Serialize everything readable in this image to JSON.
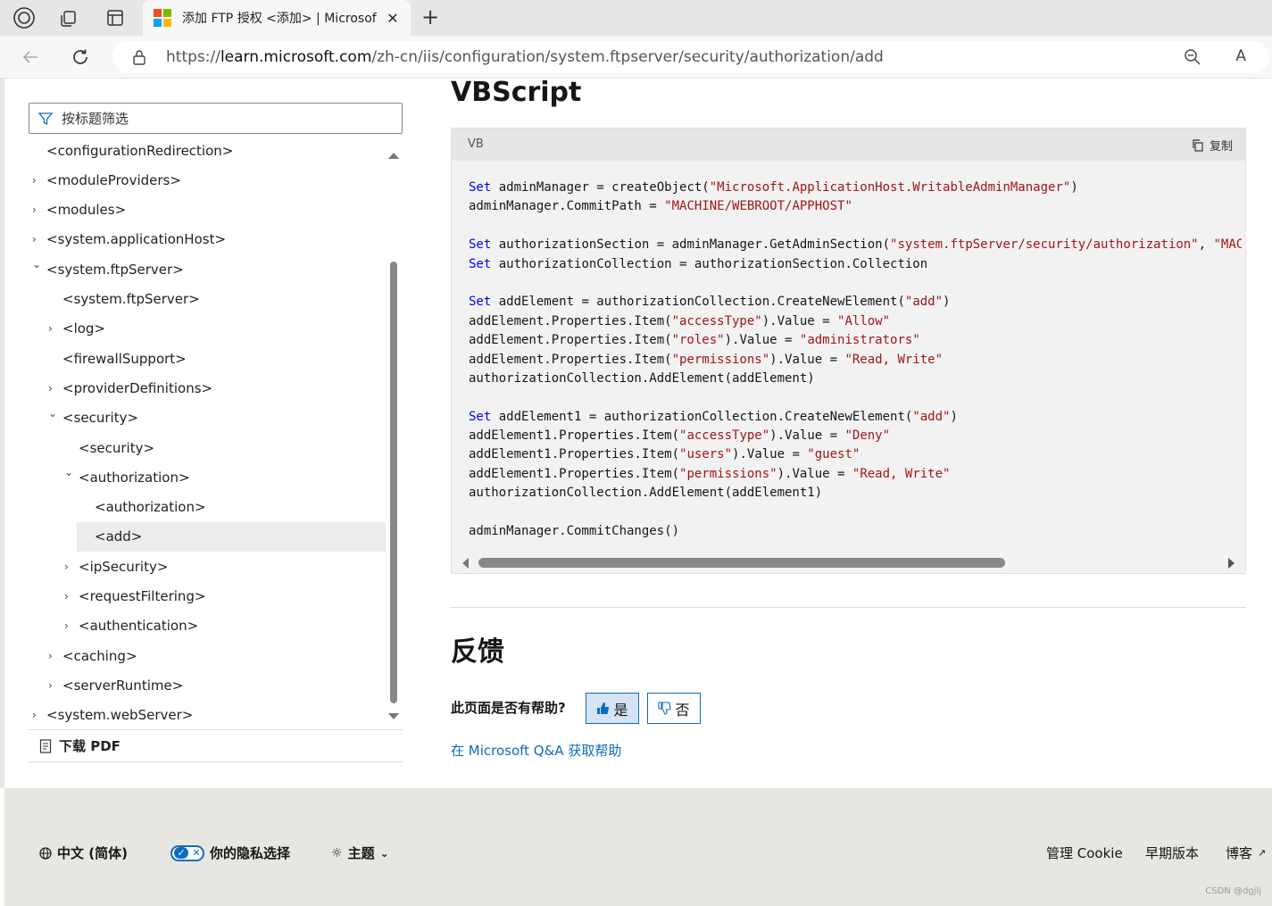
{
  "browser": {
    "tab_title": "添加 FTP 授权 <添加> | Microsof",
    "tab_close": "✕",
    "new_tab": "+",
    "url_prefix": "https://",
    "url_host": "learn.microsoft.com",
    "url_path": "/zh-cn/iis/configuration/system.ftpserver/security/authorization/add",
    "read_aloud": "A",
    "brand_colors": [
      "#f25022",
      "#7fba00",
      "#00a4ef",
      "#ffb900"
    ]
  },
  "sidebar": {
    "filter_placeholder": "按标题筛选",
    "items": [
      {
        "label": "<configurationRedirection>",
        "indent": 0,
        "chevron": ""
      },
      {
        "label": "<moduleProviders>",
        "indent": 0,
        "chevron": "›"
      },
      {
        "label": "<modules>",
        "indent": 0,
        "chevron": "›"
      },
      {
        "label": "<system.applicationHost>",
        "indent": 0,
        "chevron": "›"
      },
      {
        "label": "<system.ftpServer>",
        "indent": 0,
        "chevron": "⌄"
      },
      {
        "label": "<system.ftpServer>",
        "indent": 1,
        "chevron": ""
      },
      {
        "label": "<log>",
        "indent": 1,
        "chevron": "›"
      },
      {
        "label": "<firewallSupport>",
        "indent": 1,
        "chevron": ""
      },
      {
        "label": "<providerDefinitions>",
        "indent": 1,
        "chevron": "›"
      },
      {
        "label": "<security>",
        "indent": 1,
        "chevron": "⌄"
      },
      {
        "label": "<security>",
        "indent": 2,
        "chevron": ""
      },
      {
        "label": "<authorization>",
        "indent": 2,
        "chevron": "⌄"
      },
      {
        "label": "<authorization>",
        "indent": 3,
        "chevron": ""
      },
      {
        "label": "<add>",
        "indent": 3,
        "chevron": "",
        "selected": true
      },
      {
        "label": "<ipSecurity>",
        "indent": 2,
        "chevron": "›"
      },
      {
        "label": "<requestFiltering>",
        "indent": 2,
        "chevron": "›"
      },
      {
        "label": "<authentication>",
        "indent": 2,
        "chevron": "›"
      },
      {
        "label": "<caching>",
        "indent": 1,
        "chevron": "›"
      },
      {
        "label": "<serverRuntime>",
        "indent": 1,
        "chevron": "›"
      },
      {
        "label": "<system.webServer>",
        "indent": 0,
        "chevron": "›"
      }
    ],
    "download_pdf": "下载 PDF"
  },
  "main": {
    "heading_vbscript": "VBScript",
    "code_lang": "VB",
    "copy_label": "复制",
    "code_lines": [
      [
        [
          "kw",
          "Set"
        ],
        [
          "t",
          " adminManager = createObject("
        ],
        [
          "str",
          "\"Microsoft.ApplicationHost.WritableAdminManager\""
        ],
        [
          "t",
          ")"
        ]
      ],
      [
        [
          "t",
          "adminManager.CommitPath = "
        ],
        [
          "str",
          "\"MACHINE/WEBROOT/APPHOST\""
        ]
      ],
      [],
      [
        [
          "kw",
          "Set"
        ],
        [
          "t",
          " authorizationSection = adminManager.GetAdminSection("
        ],
        [
          "str",
          "\"system.ftpServer/security/authorization\""
        ],
        [
          "t",
          ", "
        ],
        [
          "str",
          "\"MACHINE/WEBROOT/APPHOST\""
        ],
        [
          "t",
          ")"
        ]
      ],
      [
        [
          "kw",
          "Set"
        ],
        [
          "t",
          " authorizationCollection = authorizationSection.Collection"
        ]
      ],
      [],
      [
        [
          "kw",
          "Set"
        ],
        [
          "t",
          " addElement = authorizationCollection.CreateNewElement("
        ],
        [
          "str",
          "\"add\""
        ],
        [
          "t",
          ")"
        ]
      ],
      [
        [
          "t",
          "addElement.Properties.Item("
        ],
        [
          "str",
          "\"accessType\""
        ],
        [
          "t",
          ").Value = "
        ],
        [
          "str",
          "\"Allow\""
        ]
      ],
      [
        [
          "t",
          "addElement.Properties.Item("
        ],
        [
          "str",
          "\"roles\""
        ],
        [
          "t",
          ").Value = "
        ],
        [
          "str",
          "\"administrators\""
        ]
      ],
      [
        [
          "t",
          "addElement.Properties.Item("
        ],
        [
          "str",
          "\"permissions\""
        ],
        [
          "t",
          ").Value = "
        ],
        [
          "str",
          "\"Read, Write\""
        ]
      ],
      [
        [
          "t",
          "authorizationCollection.AddElement(addElement)"
        ]
      ],
      [],
      [
        [
          "kw",
          "Set"
        ],
        [
          "t",
          " addElement1 = authorizationCollection.CreateNewElement("
        ],
        [
          "str",
          "\"add\""
        ],
        [
          "t",
          ")"
        ]
      ],
      [
        [
          "t",
          "addElement1.Properties.Item("
        ],
        [
          "str",
          "\"accessType\""
        ],
        [
          "t",
          ").Value = "
        ],
        [
          "str",
          "\"Deny\""
        ]
      ],
      [
        [
          "t",
          "addElement1.Properties.Item("
        ],
        [
          "str",
          "\"users\""
        ],
        [
          "t",
          ").Value = "
        ],
        [
          "str",
          "\"guest\""
        ]
      ],
      [
        [
          "t",
          "addElement1.Properties.Item("
        ],
        [
          "str",
          "\"permissions\""
        ],
        [
          "t",
          ").Value = "
        ],
        [
          "str",
          "\"Read, Write\""
        ]
      ],
      [
        [
          "t",
          "authorizationCollection.AddElement(addElement1)"
        ]
      ],
      [],
      [
        [
          "t",
          "adminManager.CommitChanges()"
        ]
      ]
    ],
    "heading_feedback": "反馈",
    "helpful_question": "此页面是否有帮助?",
    "yes_label": "是",
    "no_label": "否",
    "qa_link": "在 Microsoft Q&A 获取帮助"
  },
  "footer": {
    "language": "中文 (简体)",
    "privacy": "你的隐私选择",
    "theme": "主题",
    "manage_cookie": "管理 Cookie",
    "previous_versions": "早期版本",
    "blog": "博客"
  },
  "corner_credit": "CSDN @dgjlj"
}
